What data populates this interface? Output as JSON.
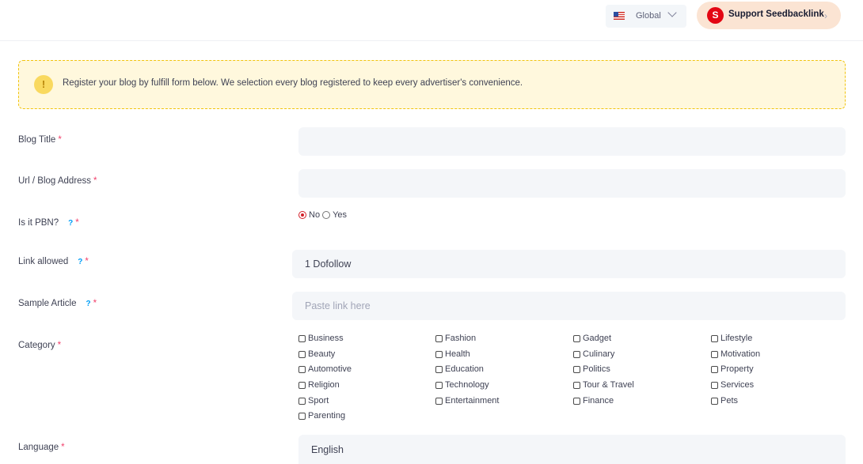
{
  "header": {
    "language_label": "Global",
    "flag_icon": "us-flag-icon",
    "support_logo_letter": "S",
    "support_label": "Support Seedbacklink",
    "support_chevron": "›"
  },
  "notice": {
    "icon": "!",
    "text": "Register your blog by fulfill form below. We selection every blog registered to keep every advertiser's convenience."
  },
  "form": {
    "required_mark": "*",
    "help_mark": "?",
    "blog_title": {
      "label": "Blog Title",
      "value": "",
      "placeholder": ""
    },
    "url": {
      "label": "Url / Blog Address",
      "value": "",
      "placeholder": ""
    },
    "pbn": {
      "label": "Is it PBN?",
      "options": [
        "No",
        "Yes"
      ],
      "selected": "No"
    },
    "link_allowed": {
      "label": "Link allowed",
      "value": "1 Dofollow"
    },
    "sample_article": {
      "label": "Sample Article",
      "placeholder": "Paste link here"
    },
    "category": {
      "label": "Category",
      "options": [
        "Business",
        "Fashion",
        "Gadget",
        "Lifestyle",
        "Beauty",
        "Health",
        "Culinary",
        "Motivation",
        "Automotive",
        "Education",
        "Politics",
        "Property",
        "Religion",
        "Technology",
        "Tour & Travel",
        "Services",
        "Sport",
        "Entertainment",
        "Finance",
        "Pets",
        "Parenting"
      ]
    },
    "language": {
      "label": "Language",
      "value": "English"
    }
  },
  "colors": {
    "accent": "#009ef7",
    "required": "#f1416c",
    "notice_bg": "#fff8dd",
    "notice_border": "#f1c40f",
    "brand_red": "#e30613",
    "support_bg": "#fbe4d3"
  }
}
